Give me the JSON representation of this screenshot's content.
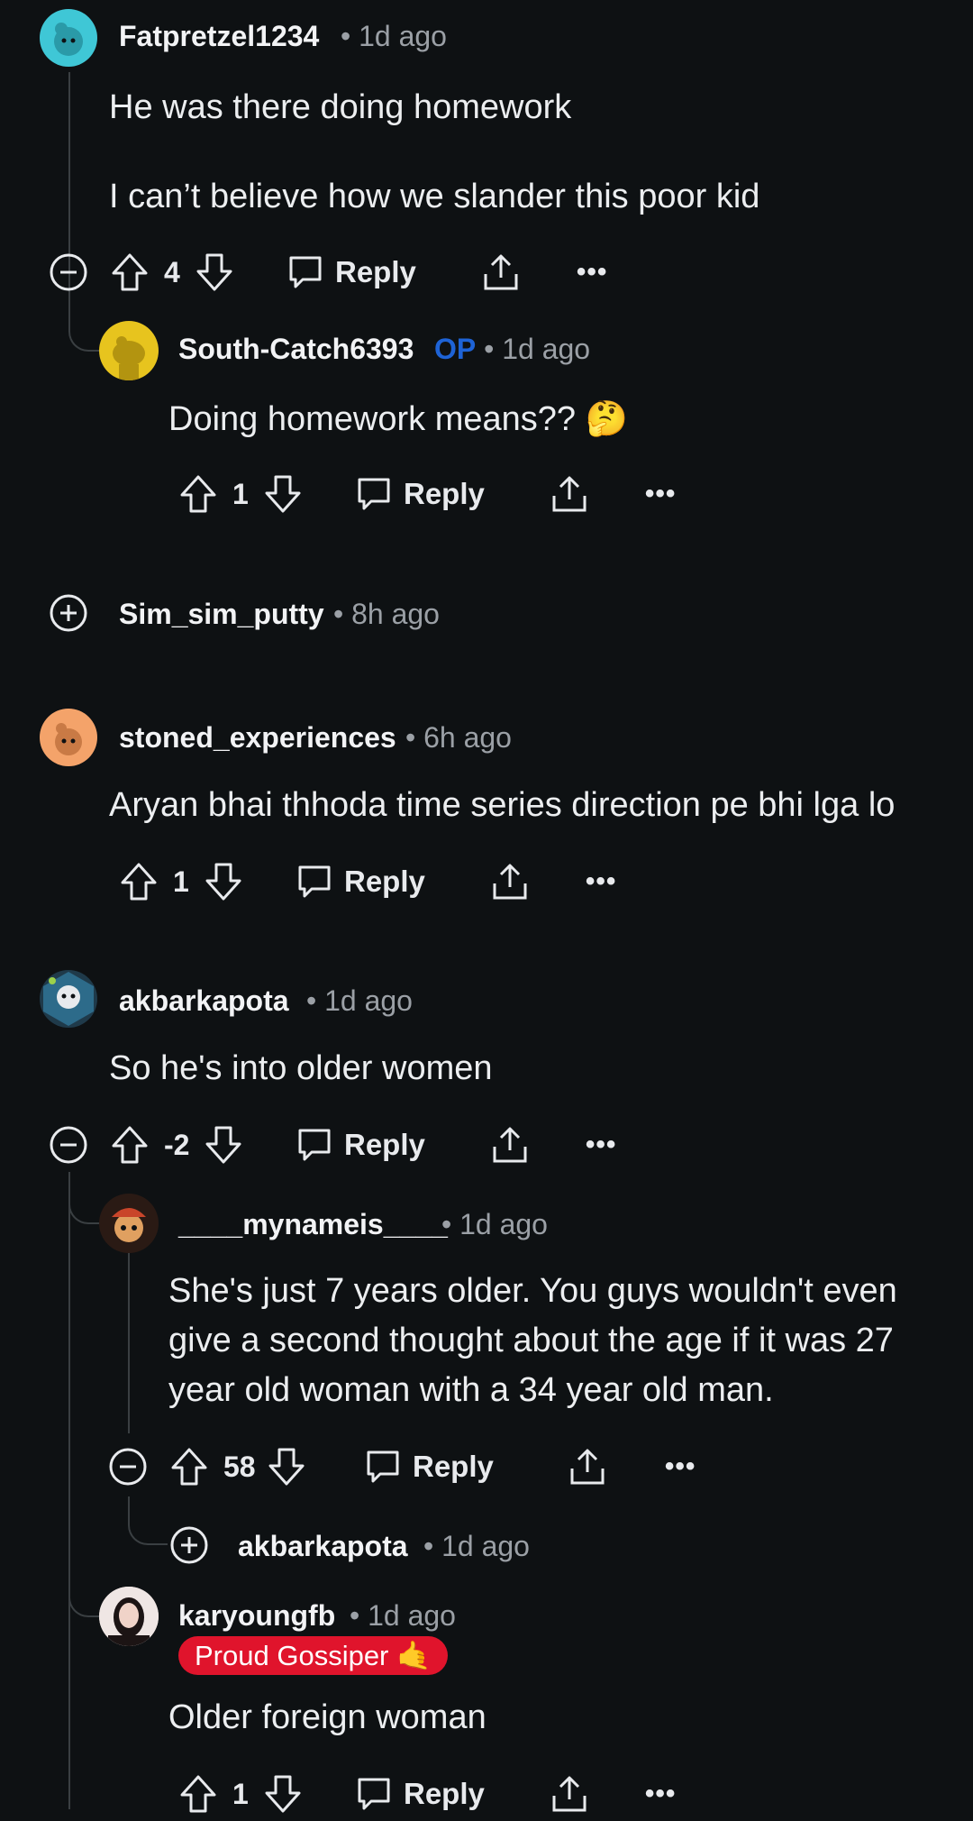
{
  "comments": [
    {
      "username": "Fatpretzel1234",
      "time": "1d ago",
      "body": [
        "He was there doing homework",
        "I can’t believe how we slander this poor kid"
      ],
      "score": "4",
      "reply": "Reply",
      "avatar_color": "#3fc7d6"
    },
    {
      "username": "South-Catch6393",
      "op": "OP",
      "time": "1d ago",
      "body": [
        "Doing homework means?? 🤔"
      ],
      "score": "1",
      "reply": "Reply",
      "avatar_color": "#e7c41e"
    },
    {
      "username": "Sim_sim_putty",
      "time": "8h ago",
      "collapsed": true
    },
    {
      "username": "stoned_experiences",
      "time": "6h ago",
      "body": [
        "Aryan bhai thhoda time series direction pe bhi lga lo"
      ],
      "score": "1",
      "reply": "Reply",
      "avatar_color": "#f4a36a"
    },
    {
      "username": "akbarkapota",
      "time": "1d ago",
      "body": [
        "So he's into older women"
      ],
      "score": "-2",
      "reply": "Reply",
      "avatar_color": "#2d6b8a"
    },
    {
      "username": "____mynameis____",
      "time": "1d ago",
      "body": [
        "She's just 7 years older. You guys wouldn't even",
        "give a second thought about the age if it was 27",
        "year old woman with a 34 year old man."
      ],
      "score": "58",
      "reply": "Reply",
      "avatar_color": "#c9452a"
    },
    {
      "username": "akbarkapota",
      "time": "1d ago",
      "collapsed": true
    },
    {
      "username": "karyoungfb",
      "time": "1d ago",
      "flair": "Proud Gossiper 🤙",
      "body": [
        "Older foreign woman"
      ],
      "score": "1",
      "reply": "Reply",
      "avatar_color": "#d8c6c2"
    }
  ],
  "dots": "•••"
}
